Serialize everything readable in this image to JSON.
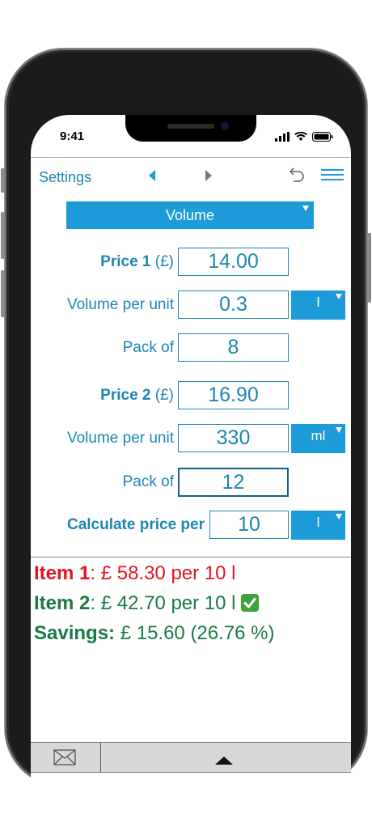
{
  "status_bar": {
    "time": "9:41"
  },
  "toolbar": {
    "settings_label": "Settings"
  },
  "mode_dropdown": {
    "selected": "Volume"
  },
  "item1": {
    "price_label": "Price 1",
    "price_currency": "(£)",
    "price_value": "14.00",
    "volume_label": "Volume per unit",
    "volume_value": "0.3",
    "volume_unit": "l",
    "pack_label": "Pack of",
    "pack_value": "8"
  },
  "item2": {
    "price_label": "Price 2",
    "price_currency": "(£)",
    "price_value": "16.90",
    "volume_label": "Volume per unit",
    "volume_value": "330",
    "volume_unit": "ml",
    "pack_label": "Pack of",
    "pack_value": "12"
  },
  "calc": {
    "label": "Calculate price per",
    "value": "10",
    "unit": "l"
  },
  "results": {
    "item1_label": "Item 1",
    "item1_text": ": £ 58.30 per 10 l",
    "item2_label": "Item 2",
    "item2_text": ": £ 42.70 per 10 l",
    "savings_label": "Savings:",
    "savings_text": " £ 15.60 (26.76 %)"
  },
  "icons": {
    "check": "check-mark-icon",
    "mail": "envelope-icon",
    "up": "triangle-up-icon"
  },
  "colors": {
    "accent": "#1d9bd8",
    "text_blue": "#1e86b4",
    "result_red": "#e4151f",
    "result_green": "#1a7a45"
  }
}
